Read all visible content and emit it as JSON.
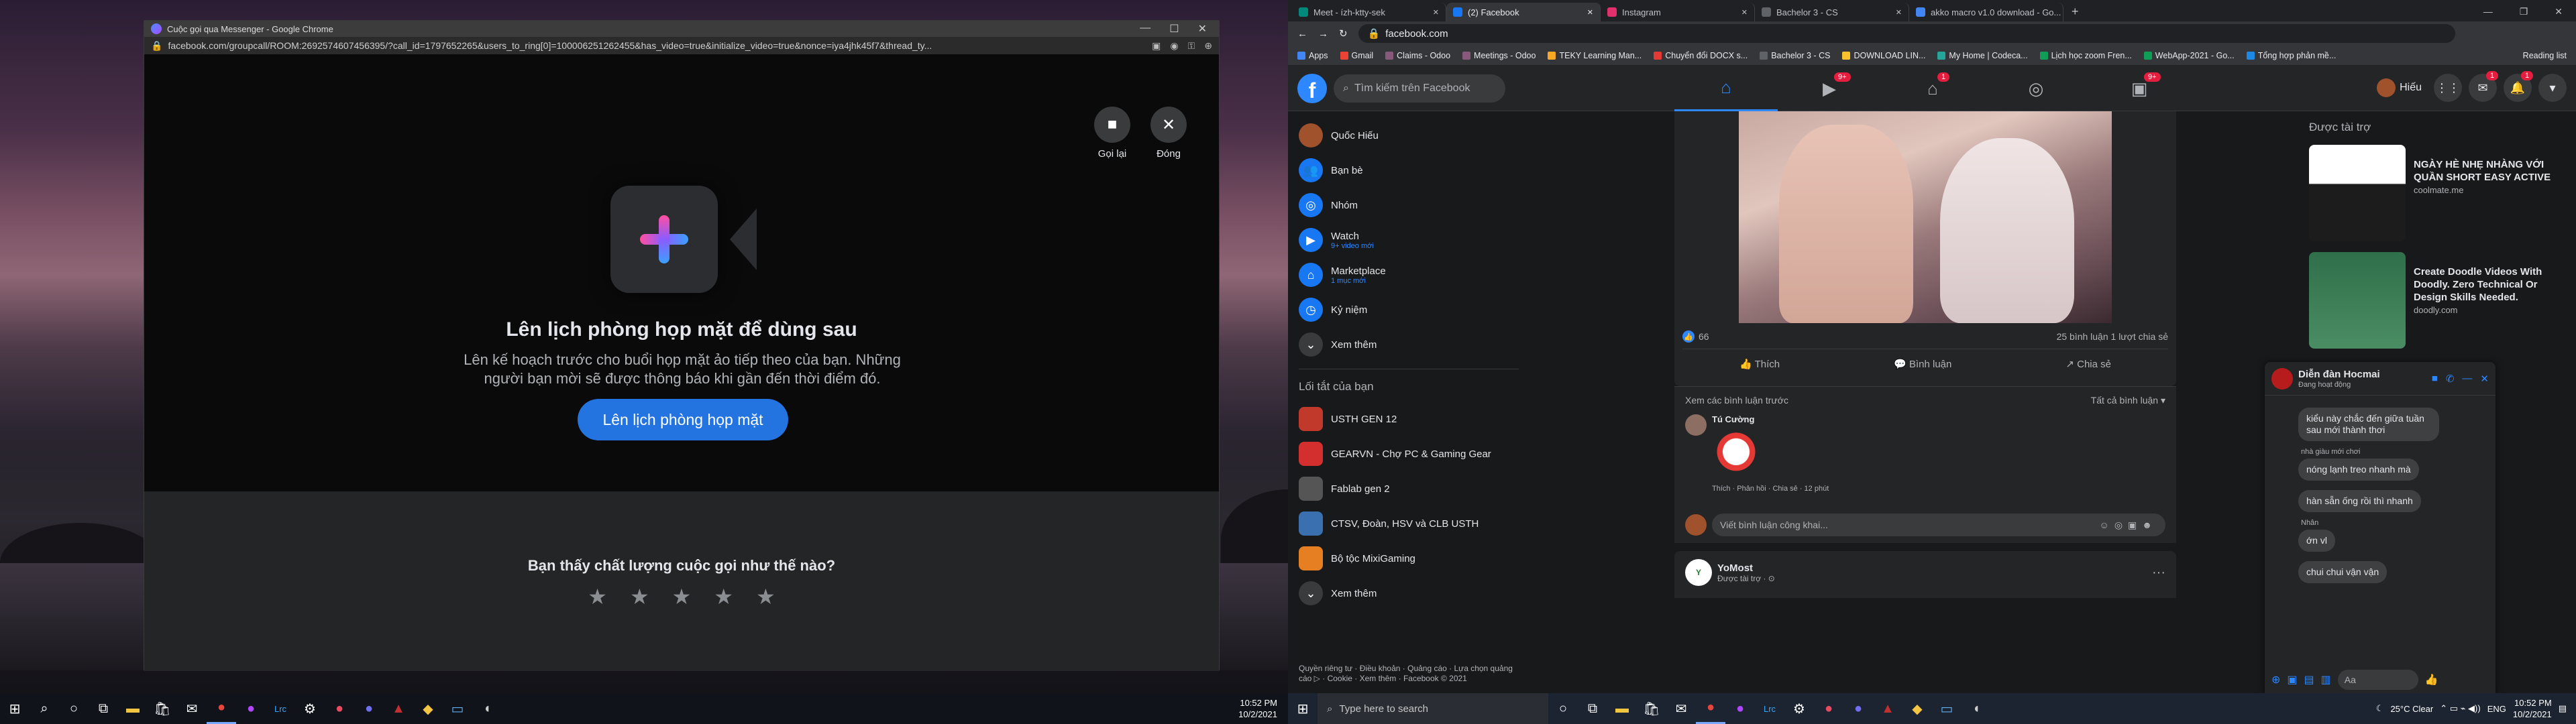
{
  "left_screen": {
    "window": {
      "title": "Cuộc gọi qua Messenger - Google Chrome",
      "url": "facebook.com/groupcall/ROOM:2692574607456395/?call_id=1797652265&users_to_ring[0]=100006251262455&has_video=true&initialize_video=true&nonce=iya4jhk45f7&thread_ty...",
      "controls": [
        "—",
        "☐",
        "✕"
      ]
    },
    "call": {
      "call_again_label": "Gọi lại",
      "close_label": "Đóng",
      "title": "Lên lịch phòng họp mặt để dùng sau",
      "description": "Lên kế hoạch trước cho buổi họp mặt ảo tiếp theo của bạn. Những người bạn mời sẽ được thông báo khi gần đến thời điểm đó.",
      "cta_label": "Lên lịch phòng họp mặt",
      "rating_question": "Bạn thấy chất lượng cuộc gọi như thế nào?",
      "star_count": 5
    },
    "taskbar": {
      "time": "10:52 PM",
      "date": "10/2/2021"
    }
  },
  "right_screen": {
    "tabs": [
      {
        "label": "Meet - ízh-ktty-sek",
        "color": "#00897b"
      },
      {
        "label": "(2) Facebook",
        "color": "#1877f2",
        "active": true
      },
      {
        "label": "Instagram",
        "color": "#e1306c"
      },
      {
        "label": "Bachelor 3 - CS",
        "color": "#5f6368"
      },
      {
        "label": "akko macro v1.0 download - Go...",
        "color": "#4285f4"
      }
    ],
    "url": "facebook.com",
    "bookmarks": [
      "Apps",
      "Gmail",
      "Claims - Odoo",
      "Meetings - Odoo",
      "TEKY Learning Man...",
      "Chuyển đổi DOCX s...",
      "Bachelor 3 - CS",
      "DOWNLOAD LIN...",
      "My Home | Codeca...",
      "Lịch học zoom Fren...",
      "WebApp-2021 - Go...",
      "Tổng hợp phản mề...",
      "Reading list"
    ],
    "fb": {
      "search_placeholder": "Tìm kiếm trên Facebook",
      "profile_name": "Hiếu",
      "nav_badges": [
        "9+",
        "1",
        "9+"
      ],
      "top_badges": [
        "1",
        "1"
      ],
      "left_menu": [
        {
          "label": "Quốc Hiếu",
          "sub": ""
        },
        {
          "label": "Bạn bè",
          "sub": ""
        },
        {
          "label": "Nhóm",
          "sub": ""
        },
        {
          "label": "Watch",
          "sub": "9+ video mới"
        },
        {
          "label": "Marketplace",
          "sub": "1 mục mới"
        },
        {
          "label": "Kỷ niệm",
          "sub": ""
        },
        {
          "label": "Xem thêm",
          "sub": ""
        }
      ],
      "shortcuts_header": "Lối tắt của bạn",
      "shortcuts": [
        {
          "label": "USTH GEN 12",
          "color": "#c0392b"
        },
        {
          "label": "GEARVN - Chợ PC & Gaming Gear",
          "color": "#d32f2f"
        },
        {
          "label": "Fablab gen 2",
          "color": "#555"
        },
        {
          "label": "CTSV, Đoàn, HSV và CLB USTH",
          "color": "#3a6fb0"
        },
        {
          "label": "Bộ tộc MixiGaming",
          "color": "#e67e22"
        },
        {
          "label": "Xem thêm",
          "color": "#3a3b3c"
        }
      ],
      "footer": "Quyền riêng tư · Điều khoản · Quảng cáo · Lựa chọn quảng cáo ▷ · Cookie · Xem thêm · Facebook © 2021",
      "post": {
        "reactions": "66",
        "comments_shares": "25 bình luận   1 lượt chia sẻ",
        "like": "Thích",
        "comment": "Bình luận",
        "share": "Chia sẻ",
        "prev_comments": "Xem các bình luận trước",
        "all_comments": "Tất cả bình luận ▾",
        "commenter": "Tú Cường",
        "comment_actions": "Thích · Phản hồi · Chia sẻ · 12 phút",
        "write_comment": "Viết bình luận công khai..."
      },
      "next_post": {
        "author": "YoMost",
        "meta": "Được tài trợ · ⊙"
      },
      "sponsored_header": "Được tài trợ",
      "ads": [
        {
          "title": "NGÀY HÈ NHẸ NHÀNG VỚI QUẦN SHORT EASY ACTIVE",
          "domain": "coolmate.me",
          "color": "#e8e8e8"
        },
        {
          "title": "Create Doodle Videos With Doodly. Zero Technical Or Design Skills Needed.",
          "domain": "doodly.com",
          "color": "#2f6f4a"
        }
      ],
      "chat": {
        "name": "Diễn đàn Hocmai",
        "status": "Đang hoạt động",
        "messages": [
          {
            "label": "",
            "text": "kiểu này chắc đến giữa tuần sau mới thành thơi"
          },
          {
            "label": "nhà giàu mới chơi",
            "text": "nóng lạnh treo nhanh mà"
          },
          {
            "label": "",
            "text": "hàn sẵn ống rồi thì nhanh"
          },
          {
            "label": "Nhân",
            "text": "ớn vl"
          },
          {
            "label": "",
            "text": "chui chui vận vận"
          }
        ],
        "input_placeholder": "Aa"
      }
    },
    "taskbar": {
      "search": "Type here to search",
      "weather": "25°C Clear",
      "lang": "ENG",
      "time": "10:52 PM",
      "date": "10/2/2021"
    }
  }
}
